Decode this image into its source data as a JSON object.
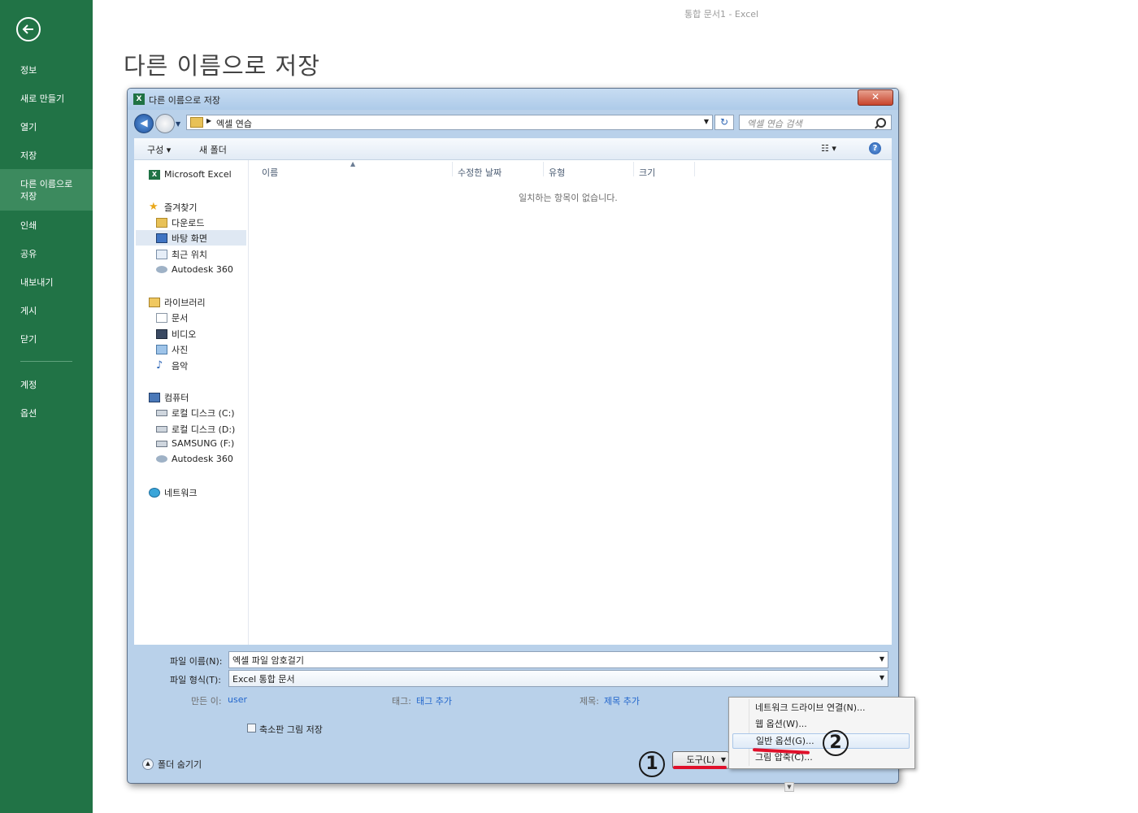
{
  "window": {
    "title": "통합 문서1 - Excel"
  },
  "backstage": {
    "page_title": "다른 이름으로 저장",
    "nav": {
      "info": "정보",
      "new": "새로 만들기",
      "open": "열기",
      "save": "저장",
      "save_as": "다른 이름으로\n저장",
      "print": "인쇄",
      "share": "공유",
      "export": "내보내기",
      "publish": "게시",
      "close": "닫기",
      "account": "계정",
      "options": "옵션"
    }
  },
  "dialog": {
    "title": "다른 이름으로 저장",
    "close_label": "✕",
    "address": {
      "path_text": "엑셀 연습",
      "search_placeholder": "엑셀 연습 검색"
    },
    "toolbar": {
      "organize": "구성 ▾",
      "new_folder": "새 폴더",
      "help": "?"
    },
    "nav_pane": {
      "excel": "Microsoft Excel",
      "favorites": "즐겨찾기",
      "downloads": "다운로드",
      "desktop": "바탕 화면",
      "recent": "최근 위치",
      "autodesk1": "Autodesk 360",
      "libraries": "라이브러리",
      "documents": "문서",
      "videos": "비디오",
      "pictures": "사진",
      "music": "음악",
      "computer": "컴퓨터",
      "drive_c": "로컬 디스크 (C:)",
      "drive_d": "로컬 디스크 (D:)",
      "drive_f": "SAMSUNG (F:)",
      "autodesk2": "Autodesk 360",
      "network": "네트워크"
    },
    "columns": {
      "name": "이름",
      "date": "수정한 날짜",
      "type": "유형",
      "size": "크기"
    },
    "empty_message": "일치하는 항목이 없습니다.",
    "filename": {
      "label": "파일 이름(N):",
      "value": "엑셀 파일 암호걸기"
    },
    "filetype": {
      "label": "파일 형식(T):",
      "value": "Excel 통합 문서"
    },
    "meta": {
      "author_label": "만든 이:",
      "author_value": "user",
      "tags_label": "태그:",
      "tags_value": "태그 추가",
      "title_label": "제목:",
      "title_value": "제목 추가"
    },
    "thumbnail_label": "축소판 그림 저장",
    "hide_folders": "폴더 숨기기",
    "buttons": {
      "tools": "도구(L)"
    }
  },
  "tools_menu": {
    "items": [
      "네트워크 드라이브 연결(N)...",
      "웹 옵션(W)...",
      "일반 옵션(G)...",
      "그림 압축(C)..."
    ]
  },
  "annotations": {
    "step1": "1",
    "step2": "2",
    "accent_color": "#e0102a"
  },
  "colors": {
    "sidebar": "#217346",
    "dialog_frame": "#b9d1ea"
  }
}
